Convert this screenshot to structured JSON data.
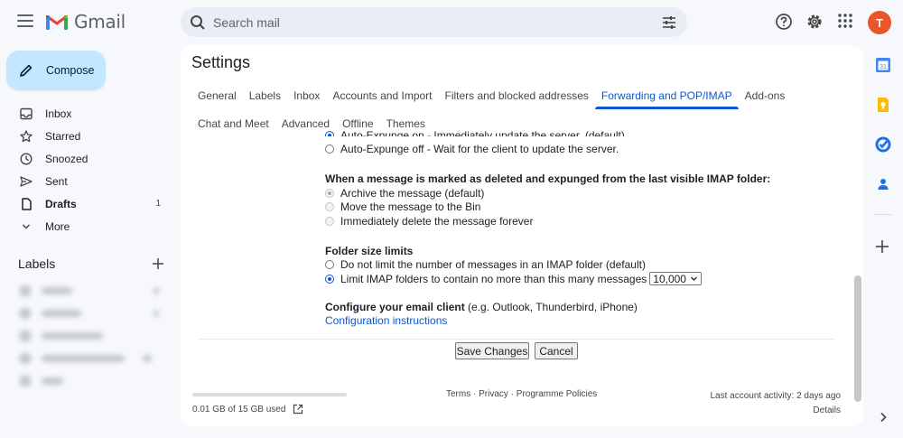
{
  "app": {
    "name": "Gmail",
    "avatar_letter": "T"
  },
  "search": {
    "placeholder": "Search mail"
  },
  "sidebar": {
    "compose_label": "Compose",
    "items": [
      {
        "label": "Inbox",
        "icon": "inbox-icon"
      },
      {
        "label": "Starred",
        "icon": "star-icon"
      },
      {
        "label": "Snoozed",
        "icon": "clock-icon"
      },
      {
        "label": "Sent",
        "icon": "send-icon"
      },
      {
        "label": "Drafts",
        "icon": "draft-icon",
        "count": "1"
      },
      {
        "label": "More",
        "icon": "chevron-down-icon"
      }
    ],
    "labels_heading": "Labels"
  },
  "settings": {
    "title": "Settings",
    "tabs_row1": [
      "General",
      "Labels",
      "Inbox",
      "Accounts and Import",
      "Filters and blocked addresses",
      "Forwarding and POP/IMAP",
      "Add-ons"
    ],
    "tabs_row2": [
      "Chat and Meet",
      "Advanced",
      "Offline",
      "Themes"
    ],
    "active_tab": "Forwarding and POP/IMAP",
    "expunge": {
      "on_label": "Auto-Expunge on - Immediately update the server. (default)",
      "off_label": "Auto-Expunge off - Wait for the client to update the server."
    },
    "deleted": {
      "heading": "When a message is marked as deleted and expunged from the last visible IMAP folder:",
      "options": [
        "Archive the message (default)",
        "Move the message to the Bin",
        "Immediately delete the message forever"
      ]
    },
    "folder_size": {
      "heading": "Folder size limits",
      "no_limit_label": "Do not limit the number of messages in an IMAP folder (default)",
      "limit_label": "Limit IMAP folders to contain no more than this many messages",
      "limit_value": "10,000"
    },
    "client": {
      "heading": "Configure your email client",
      "heading_suffix": " (e.g. Outlook, Thunderbird, iPhone)",
      "link": "Configuration instructions"
    },
    "save_label": "Save Changes",
    "cancel_label": "Cancel"
  },
  "footer": {
    "storage": "0.01 GB of 15 GB used",
    "storage_fraction": 0.001,
    "links": "Terms · Privacy · Programme Policies",
    "activity": "Last account activity: 2 days ago",
    "details": "Details"
  },
  "colors": {
    "accent": "#0b57d0",
    "compose_bg": "#c2e7ff",
    "avatar_bg": "#e8562a",
    "background": "#f6f8fc"
  }
}
